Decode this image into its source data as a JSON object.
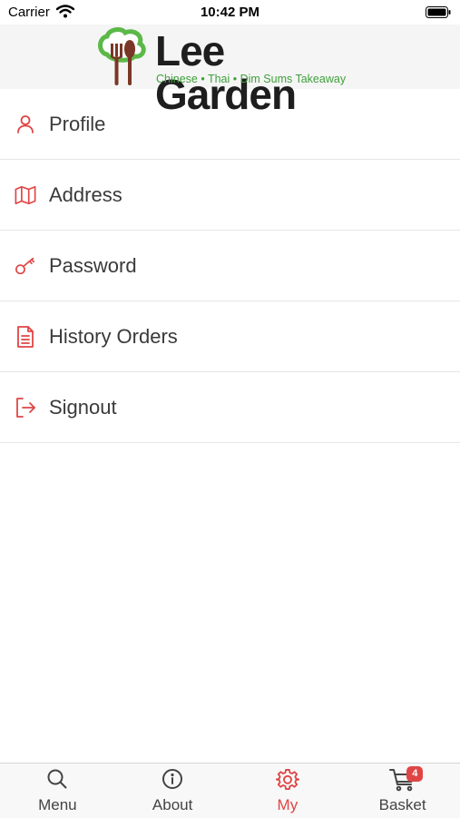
{
  "status_bar": {
    "carrier": "Carrier",
    "time": "10:42 PM"
  },
  "header": {
    "brand": "Lee Garden",
    "tagline": "Chinese • Thai • Dim Sums Takeaway"
  },
  "menu": {
    "items": [
      {
        "label": "Profile",
        "icon": "user-icon"
      },
      {
        "label": "Address",
        "icon": "map-icon"
      },
      {
        "label": "Password",
        "icon": "key-icon"
      },
      {
        "label": "History Orders",
        "icon": "document-icon"
      },
      {
        "label": "Signout",
        "icon": "sign-out-icon"
      }
    ]
  },
  "tab_bar": {
    "tabs": [
      {
        "label": "Menu",
        "icon": "search-icon",
        "active": false
      },
      {
        "label": "About",
        "icon": "info-icon",
        "active": false
      },
      {
        "label": "My",
        "icon": "gear-icon",
        "active": true
      },
      {
        "label": "Basket",
        "icon": "cart-icon",
        "active": false,
        "badge": "4"
      }
    ]
  },
  "colors": {
    "accent": "#e04545",
    "brand_green": "#3f9f3a",
    "header_bg": "#f5f5f5"
  }
}
